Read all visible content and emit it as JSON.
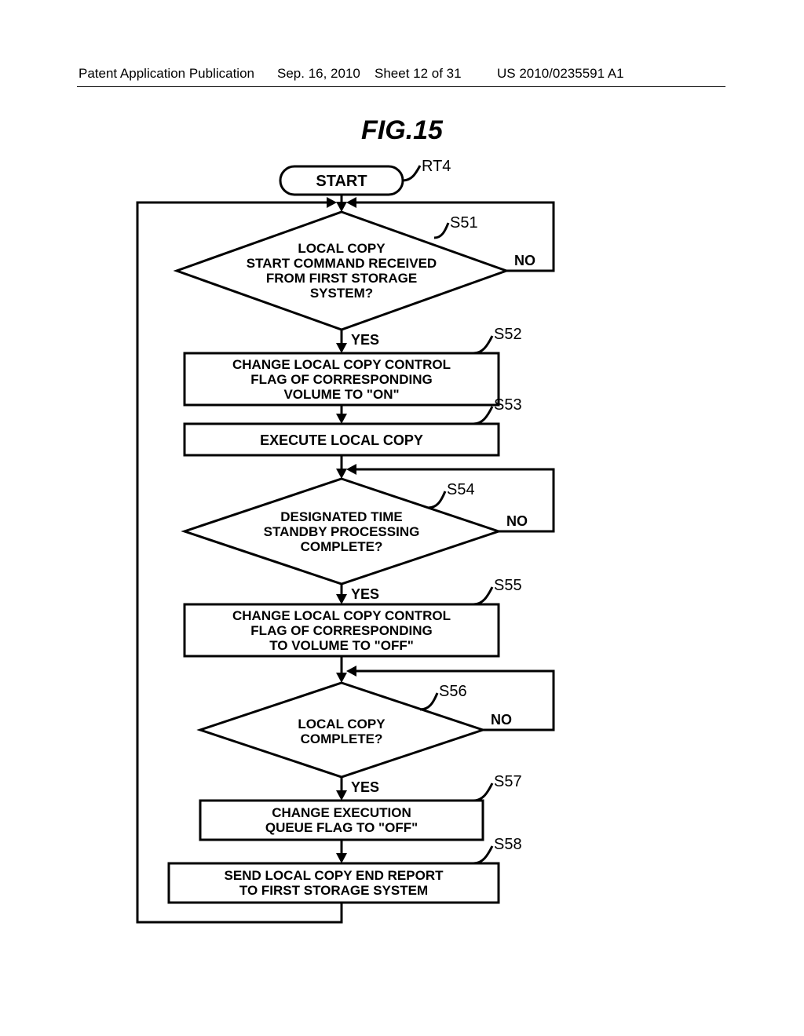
{
  "header": {
    "left": "Patent Application Publication",
    "date": "Sep. 16, 2010",
    "sheet": "Sheet 12 of 31",
    "pubno": "US 2010/0235591 A1"
  },
  "figure_title": "FIG.15",
  "flow": {
    "start": "START",
    "rt": "RT4",
    "s51": {
      "ref": "S51",
      "text1": "LOCAL COPY",
      "text2": "START COMMAND RECEIVED",
      "text3": "FROM FIRST STORAGE",
      "text4": "SYSTEM?"
    },
    "s52": {
      "ref": "S52",
      "text1": "CHANGE LOCAL COPY CONTROL",
      "text2": "FLAG OF CORRESPONDING",
      "text3": "VOLUME TO \"ON\""
    },
    "s53": {
      "ref": "S53",
      "text": "EXECUTE LOCAL COPY"
    },
    "s54": {
      "ref": "S54",
      "text1": "DESIGNATED TIME",
      "text2": "STANDBY PROCESSING",
      "text3": "COMPLETE?"
    },
    "s55": {
      "ref": "S55",
      "text1": "CHANGE LOCAL COPY CONTROL",
      "text2": "FLAG OF CORRESPONDING",
      "text3": "TO VOLUME TO \"OFF\""
    },
    "s56": {
      "ref": "S56",
      "text1": "LOCAL COPY",
      "text2": "COMPLETE?"
    },
    "s57": {
      "ref": "S57",
      "text1": "CHANGE EXECUTION",
      "text2": "QUEUE FLAG TO \"OFF\""
    },
    "s58": {
      "ref": "S58",
      "text1": "SEND LOCAL COPY END REPORT",
      "text2": "TO FIRST STORAGE SYSTEM"
    },
    "yes": "YES",
    "no": "NO"
  }
}
